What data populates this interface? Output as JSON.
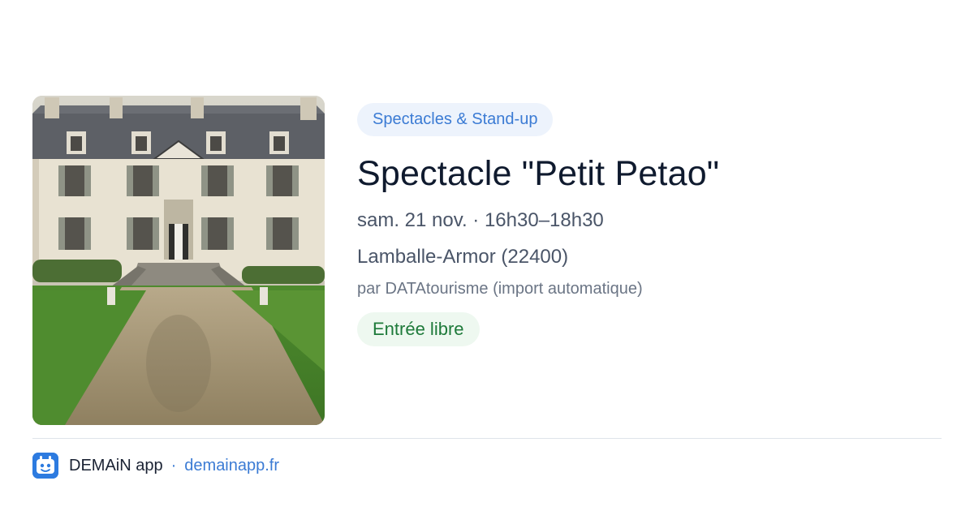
{
  "event": {
    "category": "Spectacles & Stand-up",
    "title": "Spectacle \"Petit Petao\"",
    "datetime": "sam. 21 nov. · 16h30–18h30",
    "location": "Lamballe-Armor (22400)",
    "organizer": "par DATAtourisme (import automatique)",
    "price": "Entrée libre"
  },
  "footer": {
    "app_name": "DEMAiN app",
    "separator": "·",
    "url": "demainapp.fr"
  },
  "icons": {
    "app_logo": "demain-app-logo-icon"
  },
  "colors": {
    "accent": "#3b7bd4",
    "category_bg": "#edf3fc",
    "price_text": "#1e7a3a",
    "price_bg": "#eef8f0",
    "title": "#0f1a2e",
    "meta": "#4a5568",
    "muted": "#6b7585"
  }
}
